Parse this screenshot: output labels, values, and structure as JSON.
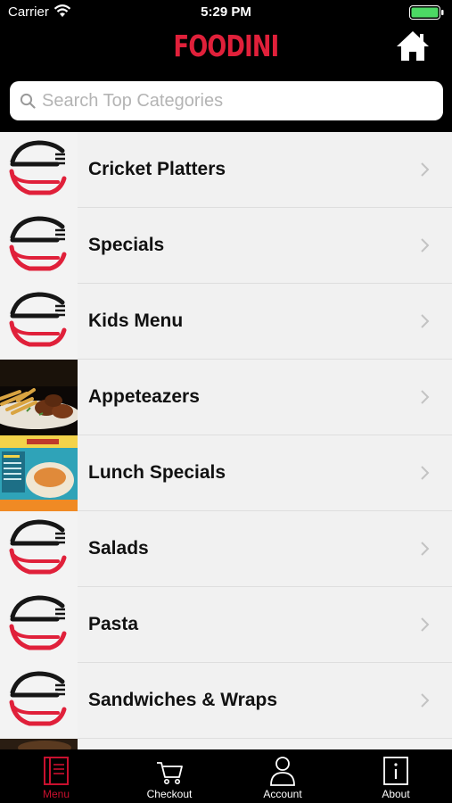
{
  "status_bar": {
    "carrier": "Carrier",
    "time": "5:29 PM",
    "battery_color": "#4cd964"
  },
  "header": {
    "title": "FOODINI",
    "home_icon": "home-icon",
    "brand_color": "#e0203a"
  },
  "search": {
    "placeholder": "Search Top Categories",
    "value": ""
  },
  "categories": [
    {
      "label": "Cricket Platters",
      "thumb": "logo"
    },
    {
      "label": "Specials",
      "thumb": "logo"
    },
    {
      "label": "Kids Menu",
      "thumb": "logo"
    },
    {
      "label": "Appeteazers",
      "thumb": "food-photo"
    },
    {
      "label": "Lunch Specials",
      "thumb": "promo-flyer"
    },
    {
      "label": "Salads",
      "thumb": "logo"
    },
    {
      "label": "Pasta",
      "thumb": "logo"
    },
    {
      "label": "Sandwiches & Wraps",
      "thumb": "logo"
    }
  ],
  "tabs": [
    {
      "label": "Menu",
      "icon": "menu-book-icon",
      "active": true
    },
    {
      "label": "Checkout",
      "icon": "cart-icon",
      "active": false
    },
    {
      "label": "Account",
      "icon": "person-icon",
      "active": false
    },
    {
      "label": "About",
      "icon": "info-icon",
      "active": false
    }
  ],
  "colors": {
    "accent": "#c8102e",
    "list_bg": "#f1f1f1",
    "bar_bg": "#000000"
  }
}
